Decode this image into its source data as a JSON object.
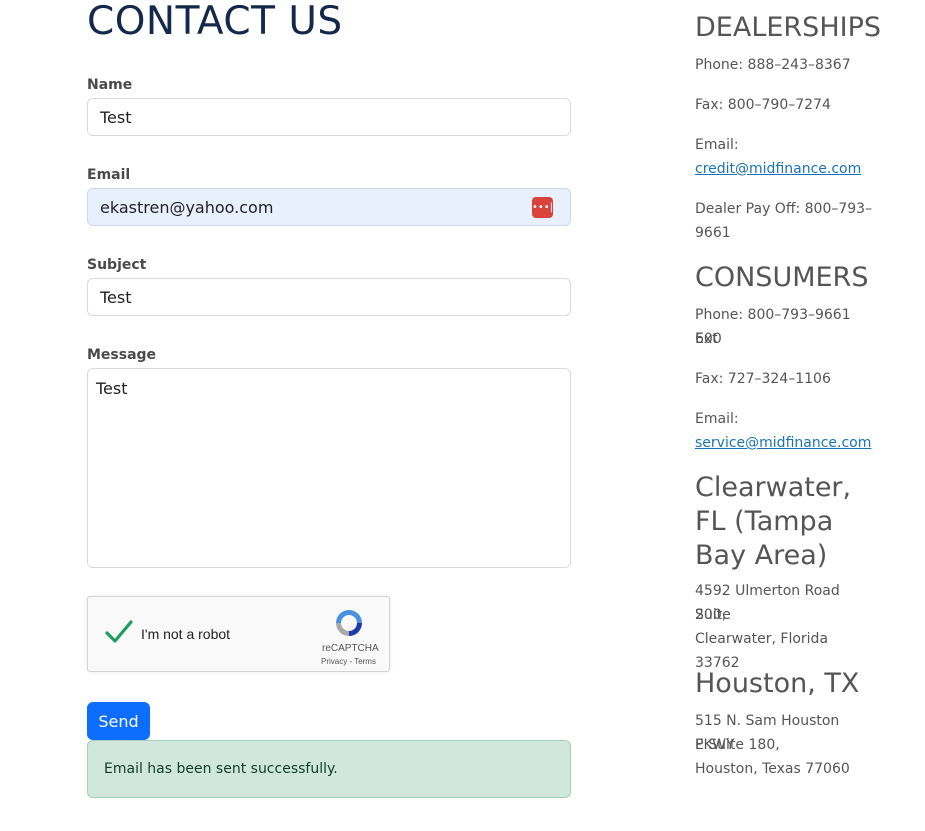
{
  "page_title": "CONTACT US",
  "form": {
    "name_label": "Name",
    "name_value": "Test",
    "email_label": "Email",
    "email_value": "ekastren@yahoo.com",
    "subject_label": "Subject",
    "subject_value": "Test",
    "message_label": "Message",
    "message_value": "Test",
    "captcha_label": "I'm not a robot",
    "captcha_brand": "reCAPTCHA",
    "captcha_links": "Privacy - Terms",
    "send_label": "Send",
    "success_message": "Email has been sent successfully."
  },
  "sidebar": {
    "dealerships": {
      "heading": "DEALERSHIPS",
      "phone": "Phone: 888–243–8367",
      "fax": "Fax: 800–790–7274",
      "email_label": "Email:",
      "email": "credit@midfinance.com",
      "payoff_line1": "Dealer Pay Off: 800–793–",
      "payoff_line2": "9661"
    },
    "consumers": {
      "heading": "CONSUMERS",
      "phone_line1": "Phone: 800–793–9661 Ext",
      "phone_line2": "600",
      "fax": "Fax: 727–324–1106",
      "email_label": "Email:",
      "email": "service@midfinance.com"
    },
    "clearwater": {
      "heading_line1": "Clearwater,",
      "heading_line2": "FL (Tampa",
      "heading_line3": "Bay Area)",
      "address_line1": "4592 Ulmerton Road Suite",
      "address_line2": "200,",
      "address_line3": "Clearwater, Florida 33762"
    },
    "houston": {
      "heading": "Houston, TX",
      "address_line1": "515 N. Sam Houston PKWY",
      "address_line2": "E Suite 180,",
      "address_line3": "Houston, Texas 77060"
    }
  },
  "icons": {
    "password_manager": "password-manager-icon",
    "captcha_check": "checkmark-icon",
    "captcha_logo": "recaptcha-logo-icon"
  },
  "colors": {
    "title": "#14284b",
    "send_button": "#0d6efd",
    "success_bg": "#d1e7dd",
    "autofill_bg": "#e8f0fe",
    "link": "#1a73b8"
  }
}
